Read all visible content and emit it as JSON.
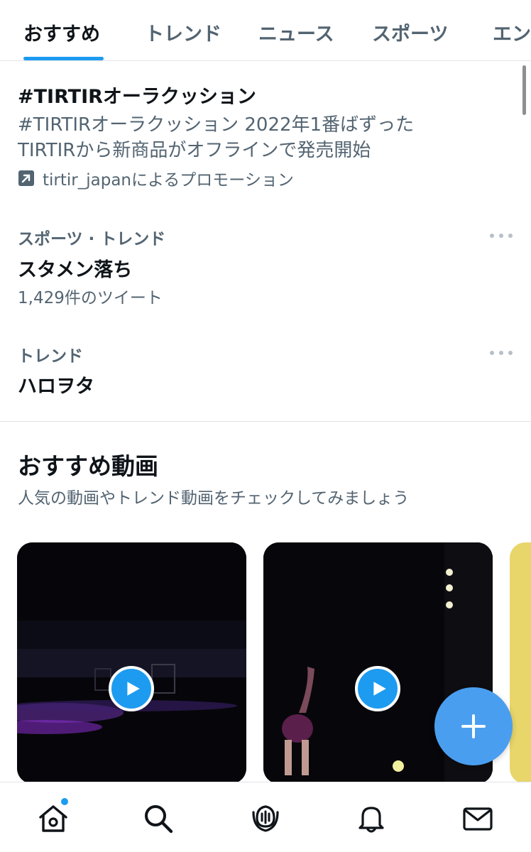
{
  "tabs": [
    {
      "label": "おすすめ",
      "active": true
    },
    {
      "label": "トレンド",
      "active": false
    },
    {
      "label": "ニュース",
      "active": false
    },
    {
      "label": "スポーツ",
      "active": false
    },
    {
      "label": "エン",
      "active": false
    }
  ],
  "promoted": {
    "title": "#TIRTIRオーラクッション",
    "description": "#TIRTIRオーラクッション 2022年1番ばずった TIRTIRから新商品がオフラインで発売開始",
    "promoted_by": "tirtir_japanによるプロモーション",
    "icon": "promoted-arrow-icon"
  },
  "trends": [
    {
      "meta": "スポーツ · トレンド",
      "name": "スタメン落ち",
      "count": "1,429件のツイート"
    },
    {
      "meta": "トレンド",
      "name": "ハロヲタ",
      "count": ""
    }
  ],
  "videos_section": {
    "title": "おすすめ動画",
    "subtitle": "人気の動画やトレンド動画をチェックしてみましょう"
  },
  "fab": {
    "icon": "plus-icon"
  },
  "bottom_nav": {
    "items": [
      {
        "icon": "home-icon",
        "has_notification": true
      },
      {
        "icon": "search-icon"
      },
      {
        "icon": "spaces-icon"
      },
      {
        "icon": "bell-icon"
      },
      {
        "icon": "mail-icon"
      }
    ]
  },
  "colors": {
    "accent": "#1d9bf0",
    "text_primary": "#0f1419",
    "text_secondary": "#536471"
  }
}
